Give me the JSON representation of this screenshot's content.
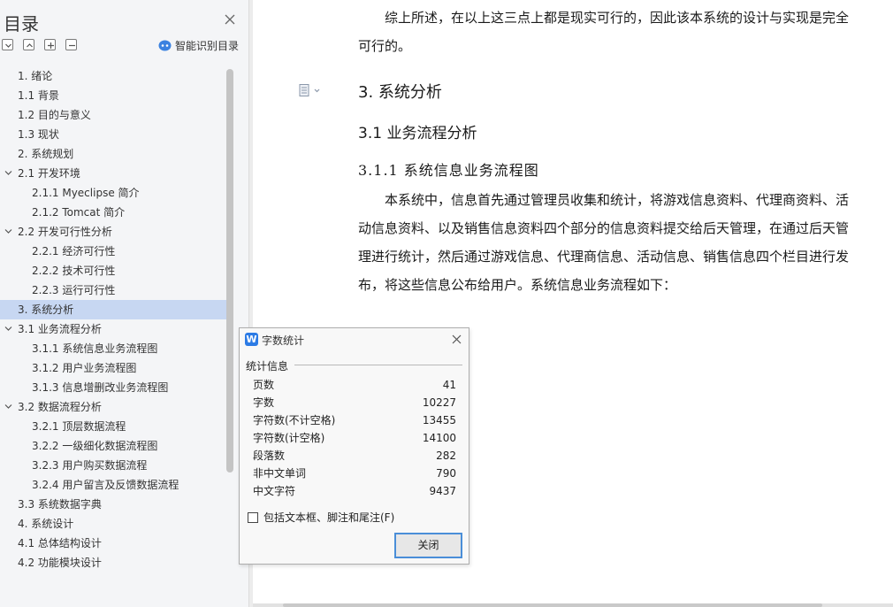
{
  "toc": {
    "title": "目录",
    "smart_label": "智能识别目录",
    "items": [
      {
        "label": "1. 绪论",
        "level": 1,
        "expand": false
      },
      {
        "label": "1.1 背景",
        "level": 1,
        "expand": false
      },
      {
        "label": "1.2 目的与意义",
        "level": 1,
        "expand": false
      },
      {
        "label": "1.3 现状",
        "level": 1,
        "expand": false
      },
      {
        "label": "2. 系统规划",
        "level": 1,
        "expand": false
      },
      {
        "label": "2.1 开发环境",
        "level": 1,
        "expand": true
      },
      {
        "label": "2.1.1 Myeclipse 简介",
        "level": 2,
        "expand": false
      },
      {
        "label": "2.1.2 Tomcat 简介",
        "level": 2,
        "expand": false
      },
      {
        "label": "2.2 开发可行性分析",
        "level": 1,
        "expand": true
      },
      {
        "label": "2.2.1 经济可行性",
        "level": 2,
        "expand": false
      },
      {
        "label": "2.2.2 技术可行性",
        "level": 2,
        "expand": false
      },
      {
        "label": "2.2.3 运行可行性",
        "level": 2,
        "expand": false
      },
      {
        "label": "3. 系统分析",
        "level": 1,
        "expand": false,
        "selected": true
      },
      {
        "label": "3.1 业务流程分析",
        "level": 1,
        "expand": true
      },
      {
        "label": "3.1.1 系统信息业务流程图",
        "level": 2,
        "expand": false
      },
      {
        "label": "3.1.2 用户业务流程图",
        "level": 2,
        "expand": false
      },
      {
        "label": "3.1.3 信息增删改业务流程图",
        "level": 2,
        "expand": false
      },
      {
        "label": "3.2 数据流程分析",
        "level": 1,
        "expand": true
      },
      {
        "label": "3.2.1 顶层数据流程",
        "level": 2,
        "expand": false
      },
      {
        "label": "3.2.2 一级细化数据流程图",
        "level": 2,
        "expand": false
      },
      {
        "label": "3.2.3 用户购买数据流程",
        "level": 2,
        "expand": false
      },
      {
        "label": "3.2.4 用户留言及反馈数据流程",
        "level": 2,
        "expand": false
      },
      {
        "label": "3.3 系统数据字典",
        "level": 1,
        "expand": false
      },
      {
        "label": "4. 系统设计",
        "level": 1,
        "expand": false
      },
      {
        "label": "4.1 总体结构设计",
        "level": 1,
        "expand": false
      },
      {
        "label": "4.2 功能模块设计",
        "level": 1,
        "expand": false
      }
    ]
  },
  "document": {
    "para_top": "综上所述，在以上这三点上都是现实可行的，因此该本系统的设计与实现是完全可行的。",
    "heading1": "3. 系统分析",
    "heading2": "3.1 业务流程分析",
    "heading3": "3.1.1 系统信息业务流程图",
    "para_body": "本系统中，信息首先通过管理员收集和统计，将游戏信息资料、代理商资料、活动信息资料、以及销售信息资料四个部分的信息资料提交给后天管理，在通过后天管理进行统计，然后通过游戏信息、代理商信息、活动信息、销售信息四个栏目进行发布，将这些信息公布给用户。系统信息业务流程如下："
  },
  "dialog": {
    "title": "字数统计",
    "group_label": "统计信息",
    "stats": [
      {
        "label": "页数",
        "value": "41"
      },
      {
        "label": "字数",
        "value": "10227"
      },
      {
        "label": "字符数(不计空格)",
        "value": "13455"
      },
      {
        "label": "字符数(计空格)",
        "value": "14100"
      },
      {
        "label": "段落数",
        "value": "282"
      },
      {
        "label": "非中文单词",
        "value": "790"
      },
      {
        "label": "中文字符",
        "value": "9437"
      }
    ],
    "checkbox_label": "包括文本框、脚注和尾注(F)",
    "close_label": "关闭"
  }
}
